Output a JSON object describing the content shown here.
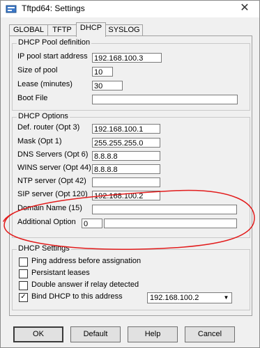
{
  "window": {
    "title": "Tftpd64: Settings",
    "close_glyph": "✕"
  },
  "tabs": [
    {
      "label": "GLOBAL"
    },
    {
      "label": "TFTP"
    },
    {
      "label": "DHCP"
    },
    {
      "label": "SYSLOG"
    }
  ],
  "pool": {
    "title": "DHCP Pool definition",
    "start_label": "IP pool start address",
    "start_value": "192.168.100.3",
    "size_label": "Size of pool",
    "size_value": "10",
    "lease_label": "Lease (minutes)",
    "lease_value": "30",
    "boot_label": "Boot File",
    "boot_value": ""
  },
  "options": {
    "title": "DHCP Options",
    "router_label": "Def. router (Opt 3)",
    "router_value": "192.168.100.1",
    "mask_label": "Mask (Opt 1)",
    "mask_value": "255.255.255.0",
    "dns_label": "DNS Servers (Opt 6)",
    "dns_value": "8.8.8.8",
    "wins_label": "WINS server (Opt 44)",
    "wins_value": "8.8.8.8",
    "ntp_label": "NTP server (Opt 42)",
    "ntp_value": "",
    "sip_label": "SIP server (Opt 120)",
    "sip_value": "192.168.100.2",
    "domain_label": "Domain Name (15)",
    "domain_value": "",
    "additional_label": "Additional Option",
    "additional_num": "0",
    "additional_value": ""
  },
  "settings": {
    "title": "DHCP Settings",
    "ping_label": "Ping address before assignation",
    "ping_checked": false,
    "persistant_label": "Persistant leases",
    "persistant_checked": false,
    "double_label": "Double answer if relay detected",
    "double_checked": false,
    "bind_label": "Bind DHCP to this address",
    "bind_checked": true,
    "bind_check_glyph": "✓",
    "bind_address": "192.168.100.2",
    "dropdown_glyph": "▼"
  },
  "buttons": {
    "ok": "OK",
    "default": "Default",
    "help": "Help",
    "cancel": "Cancel"
  },
  "colors": {
    "annotation": "#e21b1b"
  }
}
